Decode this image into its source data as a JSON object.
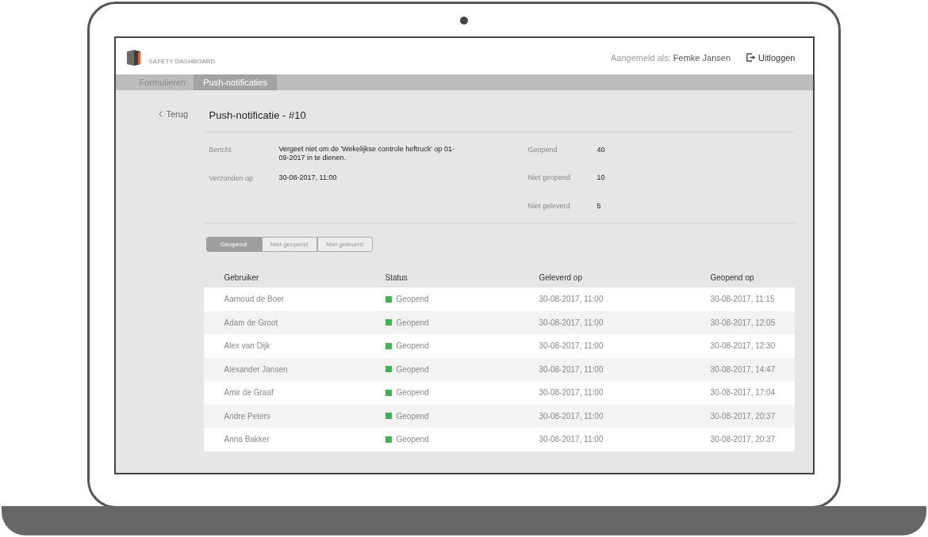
{
  "header": {
    "logo_text": "SAFETY DASHBOARD",
    "signed_in_label": "Aangemeld als:",
    "signed_in_user": "Femke Jansen",
    "logout": "Uitloggen"
  },
  "nav": [
    {
      "label": "Formulieren",
      "selected": false
    },
    {
      "label": "Push-notificaties",
      "selected": true
    }
  ],
  "back": "Terug",
  "title": "Push-notificatie - #10",
  "details": [
    {
      "label": "Bericht",
      "value": "Vergeet niet om de 'Wekelijkse controle heftruck' op 01-09-2017 in te dienen."
    },
    {
      "label": "Verzonden op",
      "value": "30-08-2017, 11:00"
    }
  ],
  "stats": [
    {
      "label": "Geopend",
      "value": "40"
    },
    {
      "label": "Niet geopend",
      "value": "10"
    },
    {
      "label": "Niet geleverd",
      "value": "5"
    }
  ],
  "filters": [
    {
      "label": "Geopend",
      "selected": true
    },
    {
      "label": "Niet geopend",
      "selected": false
    },
    {
      "label": "Niet geleverd",
      "selected": false
    }
  ],
  "table": {
    "columns": [
      "Gebruiker",
      "Status",
      "Geleverd op",
      "Geopend op"
    ],
    "rows": [
      {
        "user": "Aarnoud de Boer",
        "status": "Geopend",
        "color": "#3cb54a",
        "delivered": "30-08-2017, 11:00",
        "opened": "30-08-2017, 11:15"
      },
      {
        "user": "Adam de Groot",
        "status": "Geopend",
        "color": "#3cb54a",
        "delivered": "30-08-2017, 11:00",
        "opened": "30-08-2017, 12:05"
      },
      {
        "user": "Alex van Dijk",
        "status": "Geopend",
        "color": "#3cb54a",
        "delivered": "30-08-2017, 11:00",
        "opened": "30-08-2017, 12:30"
      },
      {
        "user": "Alexander Jansen",
        "status": "Geopend",
        "color": "#3cb54a",
        "delivered": "30-08-2017, 11:00",
        "opened": "30-08-2017, 14:47"
      },
      {
        "user": "Amir de Graaf",
        "status": "Geopend",
        "color": "#3cb54a",
        "delivered": "30-08-2017, 11:00",
        "opened": "30-08-2017, 17:04"
      },
      {
        "user": "Andre Peters",
        "status": "Geopend",
        "color": "#3cb54a",
        "delivered": "30-08-2017, 11:00",
        "opened": "30-08-2017, 20:37"
      },
      {
        "user": "Anna Bakker",
        "status": "Geopend",
        "color": "#3cb54a",
        "delivered": "30-08-2017, 11:00",
        "opened": "30-08-2017, 20:37"
      }
    ]
  }
}
